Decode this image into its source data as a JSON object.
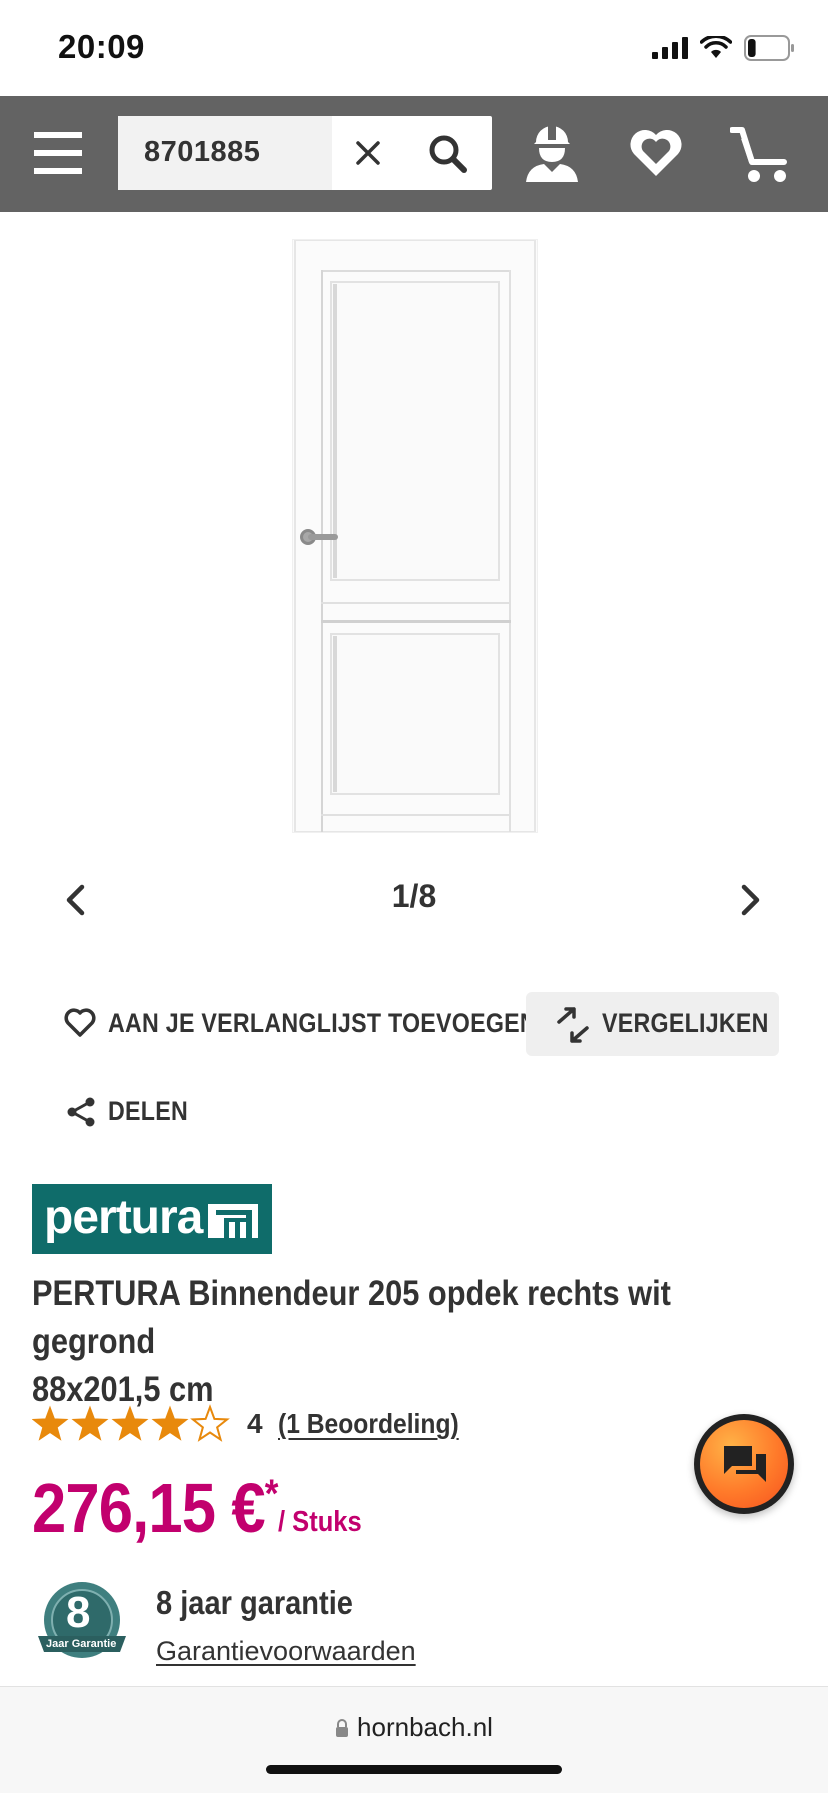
{
  "status_bar": {
    "time": "20:09",
    "battery_level": 0.2
  },
  "header": {
    "search_value": "8701885",
    "icons": [
      "menu-icon",
      "clear-icon",
      "search-icon",
      "account-icon",
      "wishlist-icon",
      "cart-icon"
    ],
    "background_color": "#636363"
  },
  "gallery": {
    "pager": "1/8"
  },
  "actions": {
    "wishlist_label": "AAN JE VERLANGLIJST TOEVOEGEN",
    "compare_label": "VERGELIJKEN",
    "share_label": "DELEN"
  },
  "product": {
    "brand": "pertura",
    "title_line1": "PERTURA Binnendeur 205 opdek rechts wit gegrond",
    "title_line2": "88x201,5 cm",
    "rating": 4,
    "rating_max": 5,
    "rating_label": "4",
    "reviews_label": "(1 Beoordeling)",
    "price": "276,15 €",
    "price_marker": "*",
    "unit": "/ Stuks",
    "price_color": "#c2006e"
  },
  "warranty": {
    "badge_number": "8",
    "badge_text": "Jaar Garantie",
    "title": "8 jaar garantie",
    "link": "Garantievoorwaarden"
  },
  "browser": {
    "url": "hornbach.nl"
  }
}
